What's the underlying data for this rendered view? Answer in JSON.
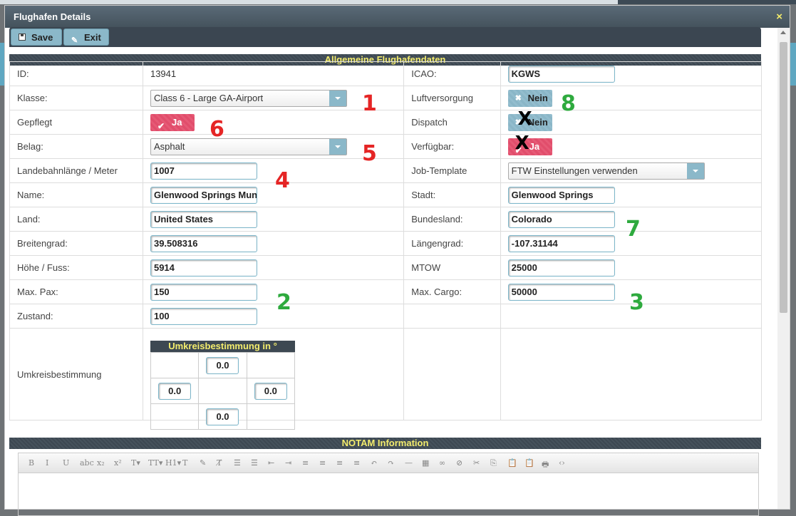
{
  "dialog": {
    "title": "Flughafen Details",
    "close_symbol": "×"
  },
  "toolbar": {
    "save_label": "Save",
    "exit_label": "Exit"
  },
  "sections": {
    "general": "Allgemeine Flughafendaten",
    "notam": "NOTAM Information"
  },
  "left": {
    "id_label": "ID:",
    "id_value": "13941",
    "klasse_label": "Klasse:",
    "klasse_value": "Class 6 - Large GA-Airport",
    "gepflegt_label": "Gepflegt",
    "gepflegt_value": "Ja",
    "belag_label": "Belag:",
    "belag_value": "Asphalt",
    "landebahn_label": "Landebahnlänge / Meter",
    "landebahn_value": "1007",
    "name_label": "Name:",
    "name_value": "Glenwood Springs Mun",
    "land_label": "Land:",
    "land_value": "United States",
    "breite_label": "Breitengrad:",
    "breite_value": "39.508316",
    "hoehe_label": "Höhe / Fuss:",
    "hoehe_value": "5914",
    "pax_label": "Max. Pax:",
    "pax_value": "150",
    "zustand_label": "Zustand:",
    "zustand_value": "100",
    "umkreis_label": "Umkreisbestimmung"
  },
  "right": {
    "icao_label": "ICAO:",
    "icao_value": "KGWS",
    "luft_label": "Luftversorgung",
    "luft_value": "Nein",
    "dispatch_label": "Dispatch",
    "dispatch_value": "Nein",
    "verf_label": "Verfügbar:",
    "verf_value": "Ja",
    "job_label": "Job-Template",
    "job_value": "FTW Einstellungen verwenden",
    "stadt_label": "Stadt:",
    "stadt_value": "Glenwood Springs",
    "bundes_label": "Bundesland:",
    "bundes_value": "Colorado",
    "laenge_label": "Längengrad:",
    "laenge_value": "-107.31144",
    "mtow_label": "MTOW",
    "mtow_value": "25000",
    "cargo_label": "Max. Cargo:",
    "cargo_value": "50000"
  },
  "umkreis": {
    "header": "Umkreisbestimmung in °",
    "north": "0.0",
    "west": "0.0",
    "east": "0.0",
    "south": "0.0"
  },
  "annotations": {
    "n1": "1",
    "n2": "2",
    "n3": "3",
    "n4": "4",
    "n5": "5",
    "n6": "6",
    "n7": "7",
    "n8": "8",
    "cross": "X",
    "red_color": "#e52525",
    "green_color": "#2eaa3e"
  },
  "editor_tools": [
    "B",
    "I",
    "U",
    "abc",
    "x₂",
    "x²",
    "T▾",
    "TT▾",
    "H1▾",
    "T",
    "✎",
    "T̸",
    "☰",
    "☰",
    "⇤",
    "⇥",
    "≡",
    "≡",
    "≡",
    "≡",
    "↶",
    "↷",
    "—",
    "▦",
    "∞",
    "⊘",
    "✂",
    "⎘",
    "📋",
    "📋",
    "🖶",
    "‹›"
  ]
}
